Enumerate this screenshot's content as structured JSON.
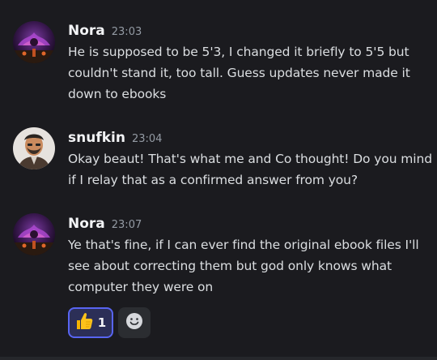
{
  "messages": [
    {
      "author": "Nora",
      "time": "23:03",
      "lines": [
        "He is supposed to be 5'3, I changed it briefly to 5'5 but",
        "couldn't stand it, too tall. Guess updates never made it",
        "down to ebooks"
      ]
    },
    {
      "author": "snufkin",
      "time": "23:04",
      "lines": [
        "Okay beaut! That's what me and Co thought! Do you mind",
        "if I relay that as a confirmed answer from you?"
      ]
    },
    {
      "author": "Nora",
      "time": "23:07",
      "lines": [
        "Ye that's fine, if I can ever find the original ebook files I'll",
        "see about correcting them but god only knows what",
        "computer they were on"
      ]
    }
  ],
  "reactions": {
    "thumbs_up": {
      "emoji": "thumbs-up-icon",
      "count": "1"
    },
    "add_reaction_icon": "smiley-add-reaction-icon"
  },
  "colors": {
    "background": "#1b1b1f",
    "username": "#f2f3f5",
    "timestamp": "#949ba4",
    "text": "#dbdee1",
    "reaction_active_bg": "#2c2f57",
    "reaction_active_border": "#5865f2",
    "reaction_idle_bg": "#2b2d31"
  }
}
